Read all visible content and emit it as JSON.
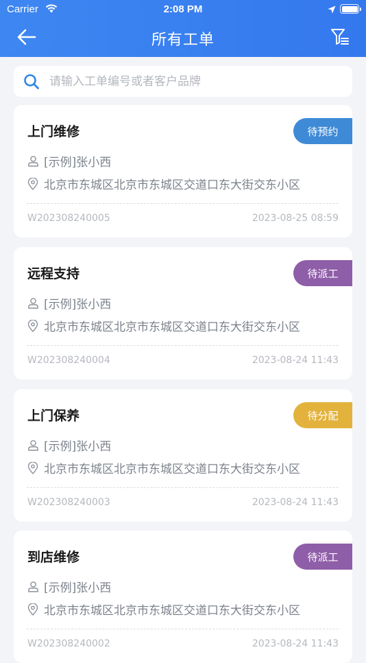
{
  "status_bar": {
    "carrier": "Carrier",
    "time": "2:08 PM"
  },
  "header": {
    "title": "所有工单",
    "back_icon": "arrow-left-icon",
    "filter_icon": "filter-list-icon"
  },
  "search": {
    "placeholder": "请输入工单编号或者客户品牌",
    "value": ""
  },
  "colors": {
    "header": "#3478ee",
    "badge_pending_appointment": "#3f8ad6",
    "badge_pending_dispatch": "#8f5ea8",
    "badge_pending_assign": "#e3b23c"
  },
  "orders": [
    {
      "title": "上门维修",
      "status": "待预约",
      "customer": "[示例]张小西",
      "address": "北京市东城区北京市东城区交道口东大街交东小区",
      "code": "W202308240005",
      "datetime": "2023-08-25 08:59"
    },
    {
      "title": "远程支持",
      "status": "待派工",
      "customer": "[示例]张小西",
      "address": "北京市东城区北京市东城区交道口东大街交东小区",
      "code": "W202308240004",
      "datetime": "2023-08-24 11:43"
    },
    {
      "title": "上门保养",
      "status": "待分配",
      "customer": "[示例]张小西",
      "address": "北京市东城区北京市东城区交道口东大街交东小区",
      "code": "W202308240003",
      "datetime": "2023-08-24 11:43"
    },
    {
      "title": "到店维修",
      "status": "待派工",
      "customer": "[示例]张小西",
      "address": "北京市东城区北京市东城区交道口东大街交东小区",
      "code": "W202308240002",
      "datetime": "2023-08-24 11:43"
    }
  ]
}
